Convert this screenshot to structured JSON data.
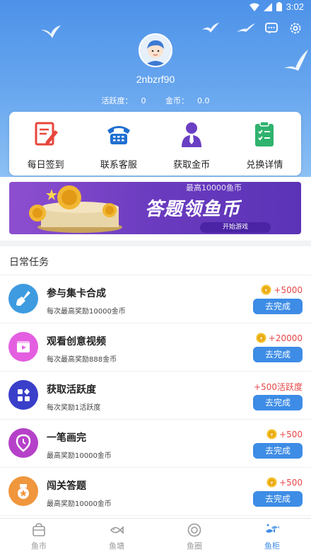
{
  "status_bar": {
    "time": "3:02"
  },
  "profile": {
    "username": "2nbzrf90",
    "activity_label": "活跃度：",
    "activity_value": "0",
    "coins_label": "金币：",
    "coins_value": "0.0"
  },
  "quick_actions": [
    {
      "label": "每日签到",
      "icon": "sign-in-icon"
    },
    {
      "label": "联系客服",
      "icon": "phone-icon"
    },
    {
      "label": "获取金币",
      "icon": "agent-icon"
    },
    {
      "label": "兑换详情",
      "icon": "clipboard-icon"
    }
  ],
  "banner": {
    "top_text": "最高10000鱼币",
    "title": "答题领鱼币",
    "button": "开始游戏"
  },
  "section_title": "日常任务",
  "tasks": [
    {
      "name": "参与集卡合成",
      "desc": "每次最高奖励10000金币",
      "reward": "+5000",
      "button": "去完成",
      "icon": "shovel-icon",
      "color": "#3e9be0"
    },
    {
      "name": "观看创意视频",
      "desc": "每次最高奖励888金币",
      "reward": "+20000",
      "button": "去完成",
      "icon": "video-icon",
      "color": "#e35fe0"
    },
    {
      "name": "获取活跃度",
      "desc": "每次奖励1活跃度",
      "reward": "+500活跃度",
      "button": "去完成",
      "icon": "apps-icon",
      "color": "#3a3fc9"
    },
    {
      "name": "一笔画完",
      "desc": "最高奖励10000金币",
      "reward": "+500",
      "button": "去完成",
      "icon": "pin-icon",
      "color": "#b641c9"
    },
    {
      "name": "闯关答题",
      "desc": "最高奖励10000金币",
      "reward": "+500",
      "button": "去完成",
      "icon": "medal-icon",
      "color": "#f0963d"
    }
  ],
  "tabs": [
    {
      "label": "鱼市",
      "icon": "market-icon",
      "active": false
    },
    {
      "label": "鱼塘",
      "icon": "fish-icon",
      "active": false
    },
    {
      "label": "鱼圈",
      "icon": "circle-icon",
      "active": false
    },
    {
      "label": "鱼柜",
      "icon": "cabinet-icon",
      "active": true
    }
  ],
  "colors": {
    "header": "#4d92e9",
    "accent": "#3d8ce6",
    "reward": "#e84545"
  }
}
